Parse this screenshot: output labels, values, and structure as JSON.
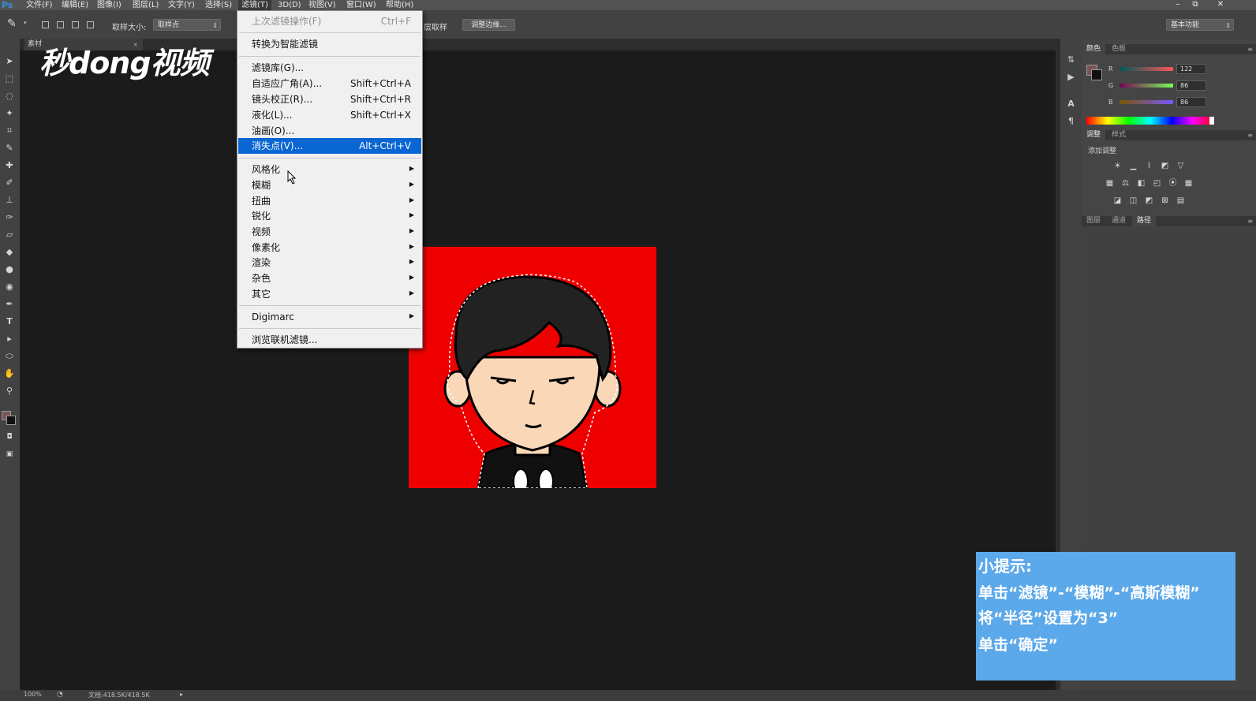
{
  "app": {
    "logo": "Ps"
  },
  "menubar": {
    "items": [
      "文件(F)",
      "编辑(E)",
      "图像(I)",
      "图层(L)",
      "文字(Y)",
      "选择(S)",
      "滤镜(T)",
      "3D(D)",
      "视图(V)",
      "窗口(W)",
      "帮助(H)"
    ],
    "active_index": 6
  },
  "window_controls": {
    "minimize": "–",
    "restore": "⧉",
    "close": "✕"
  },
  "options_bar": {
    "sample_size_label": "取样大小:",
    "sample_size_value": "取样点",
    "sample_layers_label": "层取样",
    "refine_edge_button": "调整边缘...",
    "workspace_value": "基本功能"
  },
  "document_tab": {
    "title": "素材"
  },
  "filter_menu": {
    "last_filter": {
      "label": "上次滤镜操作(F)",
      "shortcut": "Ctrl+F"
    },
    "convert_smart": "转换为智能滤镜",
    "group1": [
      {
        "label": "滤镜库(G)...",
        "shortcut": ""
      },
      {
        "label": "自适应广角(A)...",
        "shortcut": "Shift+Ctrl+A"
      },
      {
        "label": "镜头校正(R)...",
        "shortcut": "Shift+Ctrl+R"
      },
      {
        "label": "液化(L)...",
        "shortcut": "Shift+Ctrl+X"
      },
      {
        "label": "油画(O)...",
        "shortcut": ""
      },
      {
        "label": "消失点(V)...",
        "shortcut": "Alt+Ctrl+V"
      }
    ],
    "group2": [
      "风格化",
      "模糊",
      "扭曲",
      "锐化",
      "视频",
      "像素化",
      "渲染",
      "杂色",
      "其它"
    ],
    "digimarc": "Digimarc",
    "browse_online": "浏览联机滤镜..."
  },
  "panels": {
    "color_tabs": [
      "颜色",
      "色板"
    ],
    "rgb": [
      {
        "label": "R",
        "value": "122"
      },
      {
        "label": "G",
        "value": "86"
      },
      {
        "label": "B",
        "value": "86"
      }
    ],
    "adjust_tabs": [
      "调整",
      "样式"
    ],
    "add_adjustment": "添加调整",
    "layer_tabs": [
      "图层",
      "通道",
      "路径"
    ]
  },
  "status": {
    "zoom": "100%",
    "doc_info": "文档:418.5K/418.5K"
  },
  "watermark": {
    "text": "秒dong视频"
  },
  "tip": {
    "title": "小提示:",
    "lines": [
      "单击“滤镜”-“模糊”-“高斯模糊”",
      "将“半径”设置为“3”",
      "单击“确定”"
    ]
  },
  "colors": {
    "accent_highlight": "#0a66d2",
    "tip_bg": "#5ba8ea",
    "doc_bg": "#ee0000",
    "foreground_swatch": "#7a5656"
  }
}
